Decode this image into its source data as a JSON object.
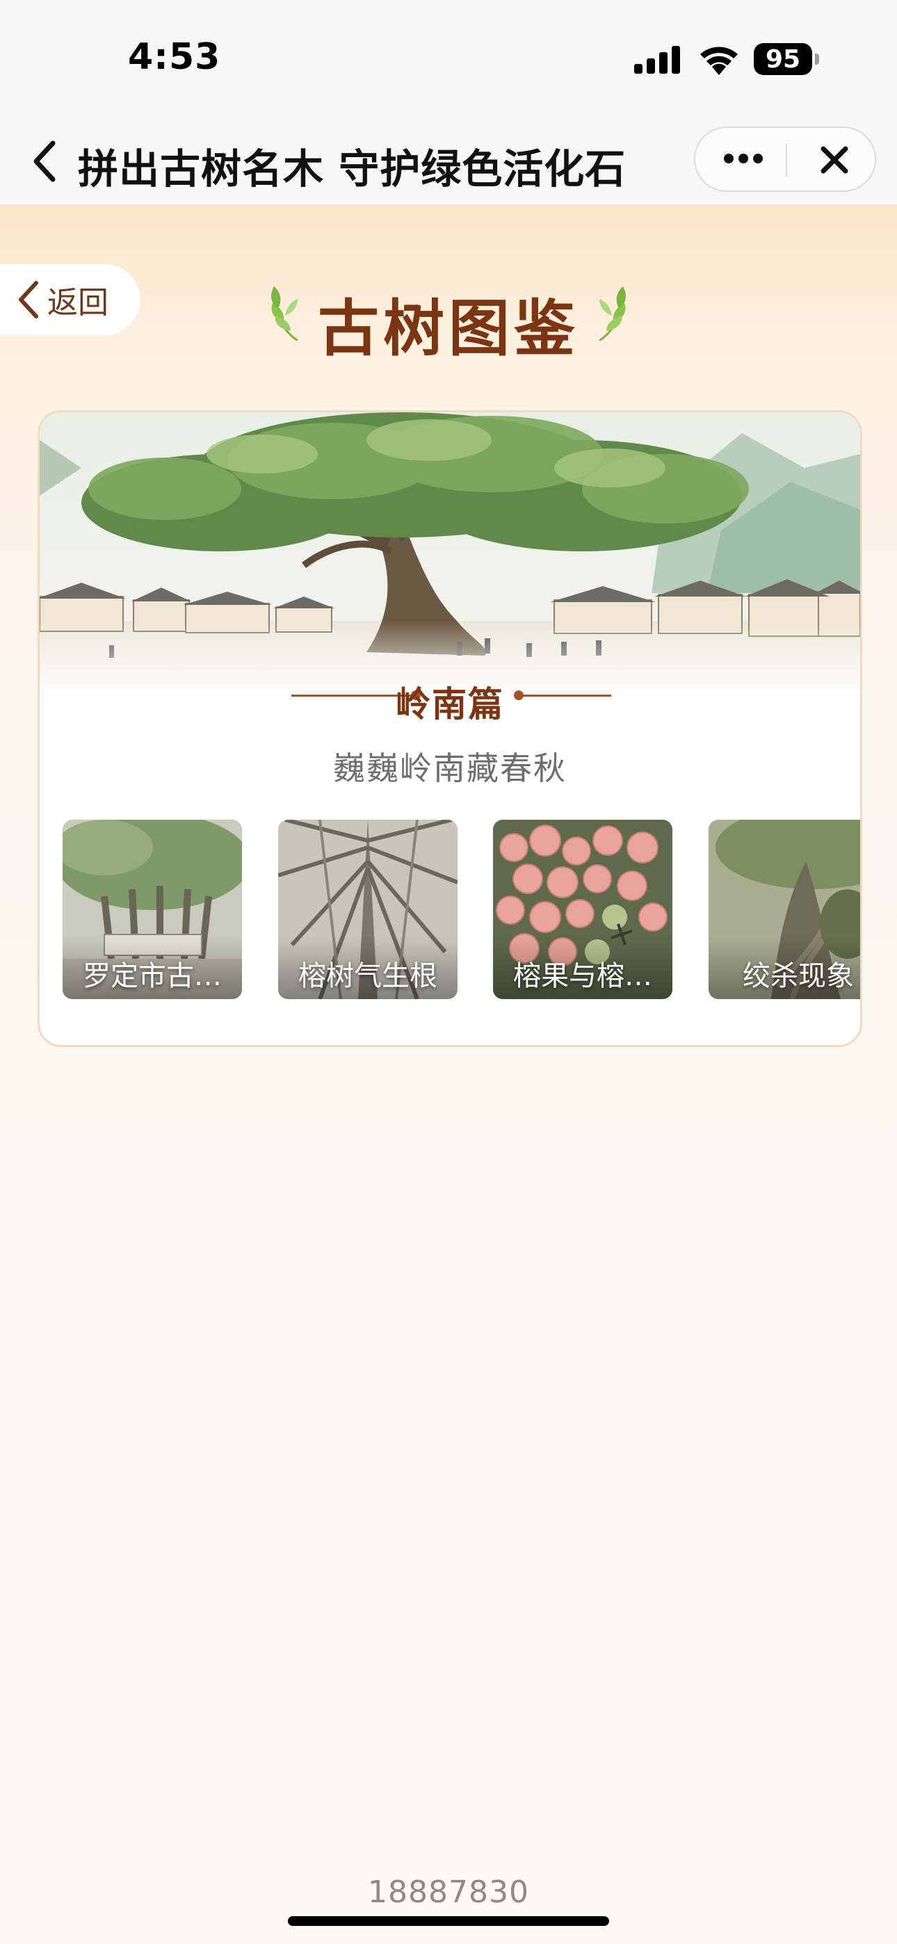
{
  "status_bar": {
    "time": "4:53",
    "battery": "95",
    "icons": [
      "signal-icon",
      "wifi-icon",
      "battery-icon"
    ]
  },
  "nav": {
    "title": "拼出古树名木 守护绿色活化石",
    "back_icon": "chevron-left-icon",
    "more_icon": "more-dots-icon",
    "close_icon": "close-icon"
  },
  "page": {
    "back_label": "返回",
    "title": "古树图鉴"
  },
  "card": {
    "section_title": "岭南篇",
    "subtitle": "巍巍岭南藏春秋",
    "items": [
      {
        "label": "罗定市古…"
      },
      {
        "label": "榕树气生根"
      },
      {
        "label": "榕果与榕…"
      },
      {
        "label": "绞杀现象"
      }
    ]
  },
  "footer": {
    "id_text": "18887830"
  },
  "colors": {
    "title_brown": "#7b3512",
    "accent_brown": "#a6532a",
    "leaf_green": "#8bc34a",
    "page_top": "#fbe5c8",
    "card_border": "#f2d9bf"
  }
}
